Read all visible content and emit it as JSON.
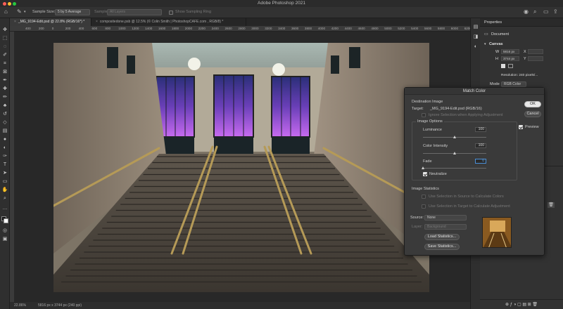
{
  "app": {
    "title": "Adobe Photoshop 2021"
  },
  "options_bar": {
    "sample_size_label": "Sample Size:",
    "sample_size_value": "5 by 5 Average",
    "sample_label": "Sample:",
    "sample_value": "All Layers",
    "show_ring_label": "Show Sampling Ring"
  },
  "tabs": [
    {
      "label": "_MG_9194-Edit.psd @ 22.8% (RGB/16*) *",
      "active": true
    },
    {
      "label": "compositedone.psb @ 12.5% (© Colin Smith | PhotoshopCAFE.com , RGB/8) *",
      "active": false
    }
  ],
  "ruler": {
    "ticks": [
      "400",
      "200",
      "0",
      "200",
      "400",
      "600",
      "800",
      "1000",
      "1200",
      "1400",
      "1600",
      "1800",
      "2000",
      "2200",
      "2400",
      "2600",
      "2800",
      "3000",
      "3200",
      "3400",
      "3600",
      "3800",
      "4000",
      "4200",
      "4400",
      "4600",
      "4800",
      "5000",
      "5200",
      "5400",
      "5600",
      "5800",
      "6000",
      "6200"
    ]
  },
  "status": {
    "zoom": "22.86%",
    "doc_info": "5816 px x 3744 px (240 ppi)"
  },
  "properties": {
    "tab": "Properties",
    "document_label": "Document",
    "canvas_label": "Canvas",
    "w_label": "W",
    "w_value": "5816 px",
    "h_label": "H",
    "h_value": "3744 px",
    "x_label": "X",
    "y_label": "Y",
    "resolution": "Resolution: 240 pixels/...",
    "mode_label": "Mode",
    "mode_value": "RGB Color"
  },
  "match_color": {
    "title": "Match Color",
    "destination_image": "Destination Image",
    "target_label": "Target:",
    "target_value": "_MG_9194-Edit.psd (RGB/16)",
    "ignore_selection": "Ignore Selection when Applying Adjustment",
    "image_options": "Image Options",
    "luminance_label": "Luminance",
    "luminance_value": "100",
    "luminance_pct": 50,
    "color_intensity_label": "Color Intensity",
    "color_intensity_value": "100",
    "color_intensity_pct": 50,
    "fade_label": "Fade",
    "fade_value": "0",
    "fade_pct": 0,
    "neutralize_label": "Neutralize",
    "image_statistics": "Image Statistics",
    "use_sel_source": "Use Selection in Source to Calculate Colors",
    "use_sel_target": "Use Selection in Target to Calculate Adjustment",
    "source_label": "Source:",
    "source_value": "None",
    "layer_label": "Layer:",
    "layer_value": "Background",
    "load_stats": "Load Statistics...",
    "save_stats": "Save Statistics...",
    "ok": "OK",
    "cancel": "Cancel",
    "preview_label": "Preview"
  }
}
